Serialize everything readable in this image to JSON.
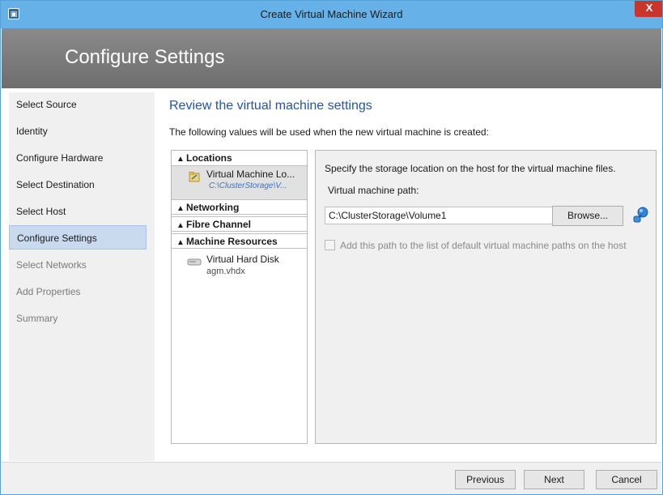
{
  "window": {
    "title": "Create Virtual Machine Wizard",
    "close_label": "X"
  },
  "header": {
    "title": "Configure Settings"
  },
  "nav": {
    "items": [
      {
        "label": "Select Source"
      },
      {
        "label": "Identity"
      },
      {
        "label": "Configure Hardware"
      },
      {
        "label": "Select Destination"
      },
      {
        "label": "Select Host"
      },
      {
        "label": "Configure Settings"
      },
      {
        "label": "Select Networks"
      },
      {
        "label": "Add Properties"
      },
      {
        "label": "Summary"
      }
    ],
    "active_index": 5
  },
  "content": {
    "title": "Review the virtual machine settings",
    "subtitle": "The following values will be used when the new virtual machine is created:"
  },
  "tree": {
    "locations": {
      "header": "Locations",
      "item_title": "Virtual Machine Lo...",
      "item_path": "C:\\ClusterStorage\\V..."
    },
    "networking": "Networking",
    "fibre_channel": "Fibre Channel",
    "machine_resources": {
      "header": "Machine Resources",
      "item_title": "Virtual Hard Disk",
      "item_sub": "agm.vhdx"
    }
  },
  "details": {
    "description": "Specify the storage location on the host for the virtual machine files.",
    "path_label": "Virtual machine path:",
    "path_value": "C:\\ClusterStorage\\Volume1",
    "browse_label": "Browse...",
    "checkbox_label": "Add this path to the list of default virtual machine paths on the host"
  },
  "footer": {
    "previous_label": "Previous",
    "next_label": "Next",
    "cancel_label": "Cancel"
  },
  "colors": {
    "titlebar": "#66b2e8",
    "header": "#7c7c7c",
    "accent_title": "#2456a0",
    "nav_active": "#c9d9ee",
    "close": "#c7352c"
  }
}
